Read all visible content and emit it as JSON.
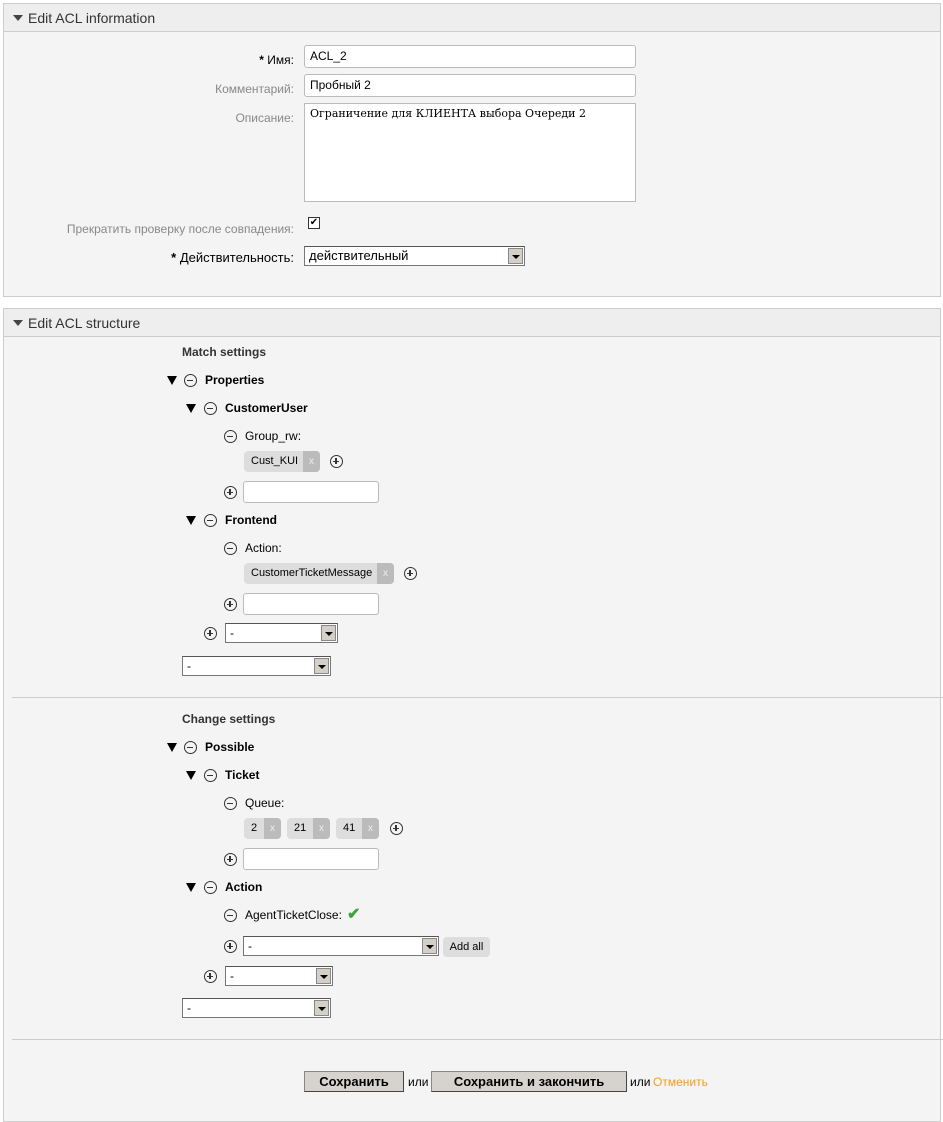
{
  "info": {
    "header": "Edit ACL information",
    "name_label": "Имя:",
    "name_value": "ACL_2",
    "comment_label": "Комментарий:",
    "comment_value": "Пробный 2",
    "description_label": "Описание:",
    "description_value": "Ограничение для КЛИЕНТА выбора Очереди 2",
    "stop_label": "Прекратить проверку после совпадения:",
    "stop_checked": true,
    "validity_label": "Действительность:",
    "validity_value": "действительный",
    "required_mark": "*"
  },
  "structure": {
    "header": "Edit ACL structure",
    "match": {
      "title": "Match settings",
      "root": "Properties",
      "customer_user": "CustomerUser",
      "group_rw": "Group_rw:",
      "group_tags": [
        "Cust_KUI"
      ],
      "frontend": "Frontend",
      "action": "Action:",
      "action_tags": [
        "CustomerTicketMessage"
      ],
      "select_value": "-"
    },
    "change": {
      "title": "Change settings",
      "root": "Possible",
      "ticket": "Ticket",
      "queue": "Queue:",
      "queue_tags": [
        "2",
        "21",
        "41"
      ],
      "action": "Action",
      "agent_ticket_close": "AgentTicketClose:",
      "add_all": "Add all",
      "select_value": "-"
    },
    "tag_remove": "x"
  },
  "footer": {
    "save": "Сохранить",
    "or1": "или",
    "save_finish": "Сохранить и закончить",
    "or2": "или",
    "cancel": "Отменить",
    "cancel_color": "#f39c22"
  },
  "colors": {
    "check": "#3aa53a"
  }
}
